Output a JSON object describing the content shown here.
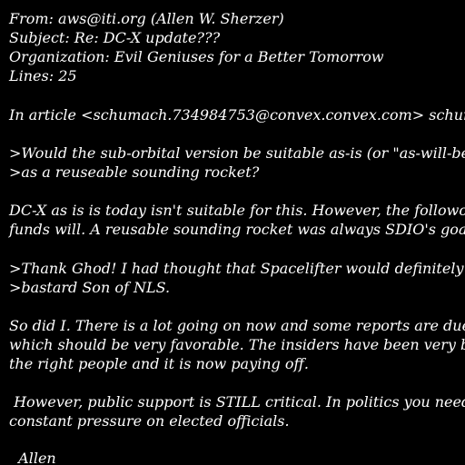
{
  "header": {
    "from": "From: aws@iti.org (Allen W. Sherzer)",
    "subject": "Subject: Re: DC-X update???",
    "organization": "Organization: Evil Geniuses for a Better Tomorrow",
    "lines": "Lines: 25"
  },
  "body": {
    "attribution": "In article <schumach.734984753@convex.convex.com> schumach",
    "quote1": [
      ">Would the sub-orbital version be suitable as-is (or \"as-will-be\") f",
      ">as a reuseable sounding rocket?"
    ],
    "para1": [
      "DC-X as is is today isn't suitable for this. However, the followon SDI",
      "funds will. A reusable sounding rocket was always SDIO's goal."
    ],
    "quote2": [
      ">Thank Ghod! I had thought that Spacelifter would definitely be t",
      ">bastard Son of NLS."
    ],
    "para2": [
      "So did I. There is a lot going on now and some reports are due soo",
      "which should be very favorable. The insiders have been very bush",
      "the right people and it is now paying off."
    ],
    "para3": [
      " However, public support is STILL critical. In politics you need to k",
      "constant pressure on elected officials."
    ],
    "signature": "  Allen"
  },
  "colors": {
    "background": "#000000",
    "text": "#ffffff"
  }
}
